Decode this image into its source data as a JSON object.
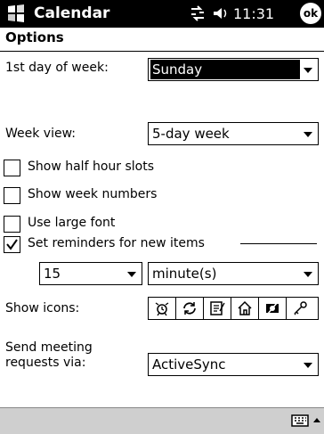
{
  "titlebar": {
    "app_title": "Calendar",
    "time": "11:31",
    "ok_label": "ok",
    "icons": [
      "start-menu-icon",
      "connectivity-icon",
      "speaker-icon"
    ]
  },
  "page": {
    "title": "Options"
  },
  "first_day": {
    "label": "1st day of week:",
    "value": "Sunday"
  },
  "week_view": {
    "label": "Week view:",
    "value": "5-day week"
  },
  "checkboxes": [
    {
      "label": "Show half hour slots",
      "checked": false
    },
    {
      "label": "Show week numbers",
      "checked": false
    },
    {
      "label": "Use large font",
      "checked": false
    },
    {
      "label": "Set reminders for new items",
      "checked": true
    }
  ],
  "reminder": {
    "amount": "15",
    "unit": "minute(s)"
  },
  "show_icons": {
    "label": "Show icons:",
    "icons": [
      "alarm-icon",
      "recurrence-icon",
      "note-icon",
      "home-icon",
      "private-icon",
      "key-icon"
    ]
  },
  "send_meeting": {
    "label_line1": "Send meeting",
    "label_line2": "requests via:",
    "value": "ActiveSync"
  },
  "bottombar": {
    "icons": [
      "keyboard-icon",
      "input-selector-arrow-icon"
    ]
  }
}
